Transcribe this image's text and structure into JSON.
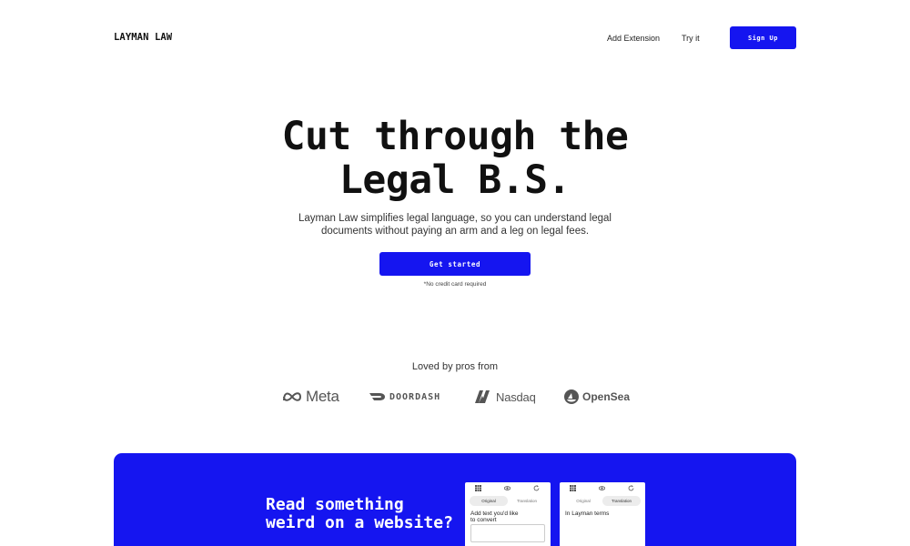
{
  "nav": {
    "logo": "LAYMAN LAW",
    "links": [
      "Add Extension",
      "Try it"
    ],
    "signup_label": "Sign Up"
  },
  "hero": {
    "title_line1": "Cut through the",
    "title_line2": "Legal B.S.",
    "subtitle_line1": "Layman Law simplifies legal language, so you can understand legal",
    "subtitle_line2": "documents without paying an arm and a leg on legal fees.",
    "cta_label": "Get started",
    "note": "*No credit card required"
  },
  "social_proof": {
    "heading": "Loved by pros from",
    "brands": [
      "Meta",
      "DOORDASH",
      "Nasdaq",
      "OpenSea"
    ],
    "icons": [
      "meta-logo-icon",
      "doordash-logo-icon",
      "nasdaq-logo-icon",
      "opensea-logo-icon"
    ]
  },
  "feature": {
    "heading_line1": "Read something",
    "heading_line2": "weird on a website?",
    "panel_left": {
      "tab_original": "Original",
      "tab_translation": "Translation",
      "text_line1": "Add text you'd like",
      "text_line2": "to convert"
    },
    "panel_right": {
      "tab_original": "Original",
      "tab_translation": "Translation",
      "text": "In Layman terms"
    },
    "panel_icons": [
      "grid-icon",
      "eye-icon",
      "refresh-icon"
    ]
  },
  "colors": {
    "accent": "#1515f0",
    "text": "#111111",
    "muted": "#555555"
  }
}
